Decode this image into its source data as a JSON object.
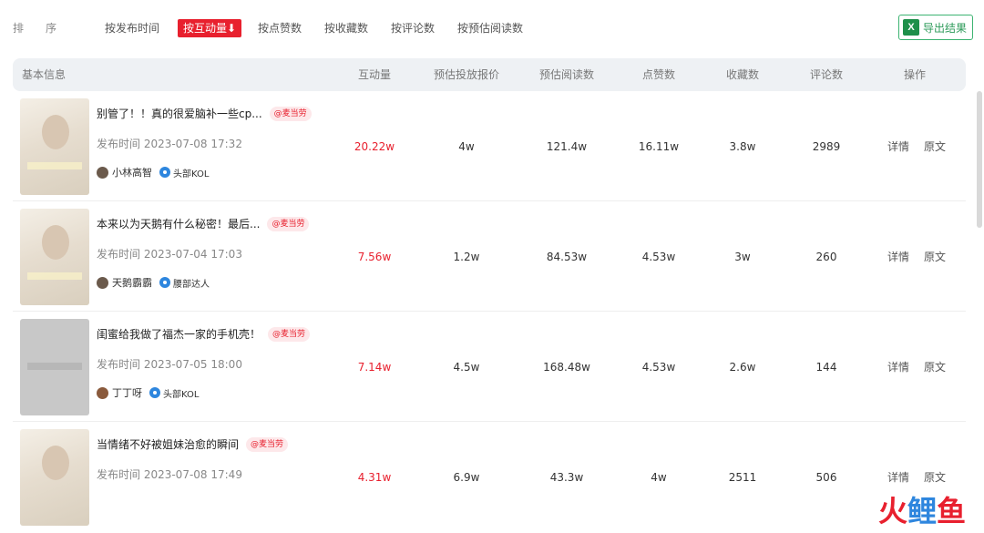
{
  "sort": {
    "label": "排序",
    "items": [
      "按发布时间",
      "按互动量⬇",
      "按点赞数",
      "按收藏数",
      "按评论数",
      "按预估阅读数"
    ],
    "active_index": 1
  },
  "export": {
    "icon": "excel-icon",
    "icon_text": "X",
    "label": "导出结果"
  },
  "header": {
    "basic": "基本信息",
    "interaction": "互动量",
    "price": "预估投放报价",
    "reads": "预估阅读数",
    "likes": "点赞数",
    "favorites": "收藏数",
    "comments": "评论数",
    "action": "操作"
  },
  "rows": [
    {
      "title": "别管了！！真的很爱脑补一些cp...",
      "tag": "@麦当劳",
      "pubtime": "发布时间 2023-07-08 17:32",
      "author": "小林高智",
      "level": "头部KOL",
      "interaction": "20.22w",
      "price": "4w",
      "reads": "121.4w",
      "likes": "16.11w",
      "favorites": "3.8w",
      "comments": "2989",
      "detail": "详情",
      "original": "原文"
    },
    {
      "title": "本来以为天鹅有什么秘密！最后...",
      "tag": "@麦当劳",
      "pubtime": "发布时间 2023-07-04 17:03",
      "author": "天鹅霸霸",
      "level": "腰部达人",
      "interaction": "7.56w",
      "price": "1.2w",
      "reads": "84.53w",
      "likes": "4.53w",
      "favorites": "3w",
      "comments": "260",
      "detail": "详情",
      "original": "原文"
    },
    {
      "title": "闺蜜给我做了福杰一家的手机壳！",
      "tag": "@麦当劳",
      "pubtime": "发布时间 2023-07-05 18:00",
      "author": "丁丁呀",
      "level": "头部KOL",
      "interaction": "7.14w",
      "price": "4.5w",
      "reads": "168.48w",
      "likes": "4.53w",
      "favorites": "2.6w",
      "comments": "144",
      "detail": "详情",
      "original": "原文"
    },
    {
      "title": "当情绪不好被姐妹治愈的瞬间",
      "tag": "@麦当劳",
      "pubtime": "发布时间 2023-07-08 17:49",
      "interaction": "4.31w",
      "price": "6.9w",
      "reads": "43.3w",
      "likes": "4w",
      "favorites": "2511",
      "comments": "506",
      "detail": "详情",
      "original": "原文"
    }
  ],
  "logo": {
    "c1": "火",
    "c2": "鲤",
    "c3": "鱼"
  },
  "colors": {
    "accent": "#e8202e",
    "excel": "#1e8f4a",
    "kol": "#2e86de"
  }
}
